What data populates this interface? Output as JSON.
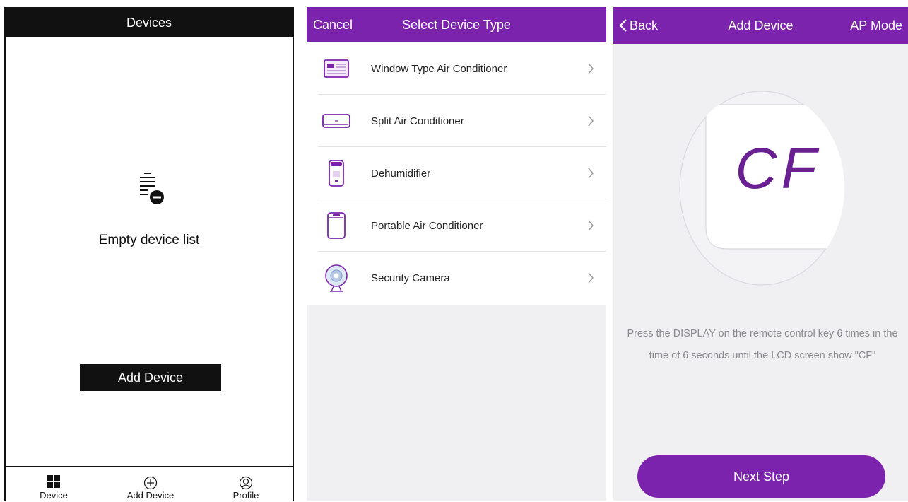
{
  "panel1": {
    "header_title": "Devices",
    "empty_text": "Empty device list",
    "add_button": "Add Device",
    "tabs": [
      {
        "label": "Device",
        "icon": "grid-icon"
      },
      {
        "label": "Add Device",
        "icon": "plus-circle-icon"
      },
      {
        "label": "Profile",
        "icon": "profile-icon"
      }
    ]
  },
  "panel2": {
    "cancel": "Cancel",
    "title": "Select Device Type",
    "items": [
      {
        "label": "Window Type Air Conditioner",
        "icon": "window-ac-icon"
      },
      {
        "label": "Split Air Conditioner",
        "icon": "split-ac-icon"
      },
      {
        "label": "Dehumidifier",
        "icon": "dehumidifier-icon"
      },
      {
        "label": "Portable Air Conditioner",
        "icon": "portable-ac-icon"
      },
      {
        "label": "Security Camera",
        "icon": "camera-icon"
      }
    ]
  },
  "panel3": {
    "back": "Back",
    "title": "Add Device",
    "ap_mode": "AP Mode",
    "lcd_text": "CF",
    "instruction": "Press the DISPLAY on the remote control key 6 times in the time of 6 seconds until the LCD screen show \"CF\"",
    "next_button": "Next Step"
  },
  "colors": {
    "accent": "#7b23ad",
    "black": "#111111",
    "background_gray": "#f0f0f2"
  }
}
